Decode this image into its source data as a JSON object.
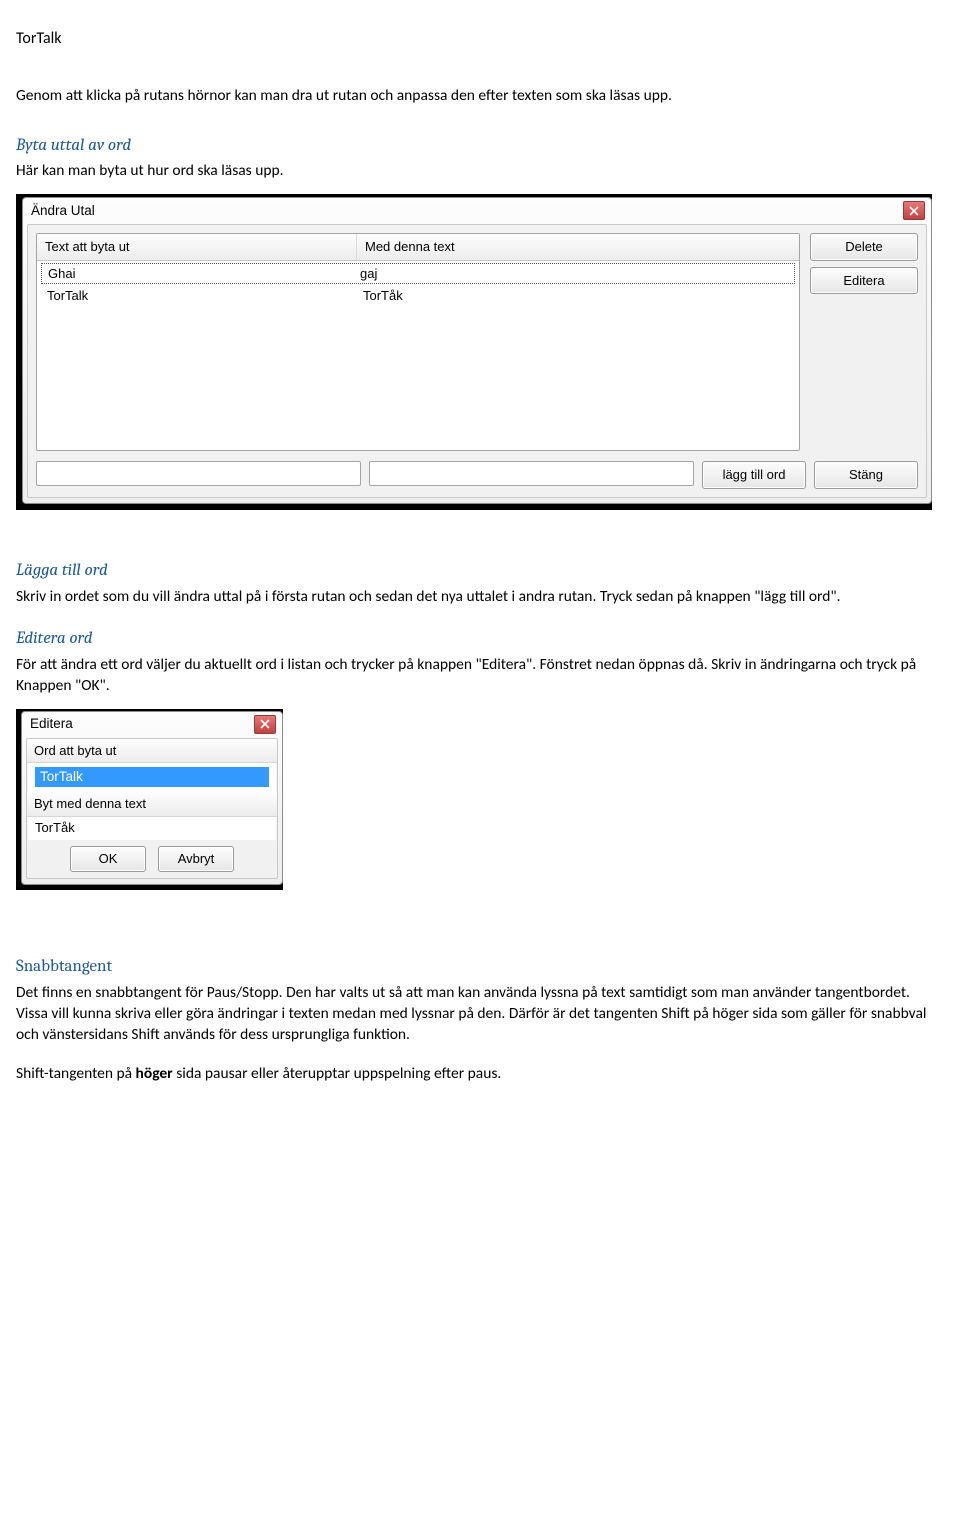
{
  "page": {
    "title": "TorTalk",
    "intro": "Genom att klicka på rutans hörnor kan man dra ut rutan och anpassa den efter texten som ska läsas upp."
  },
  "sec_byta": {
    "heading": "Byta uttal av ord",
    "text": "Här kan man byta ut hur ord ska läsas upp."
  },
  "andra_utal": {
    "title": "Ändra Utal",
    "col1": "Text att byta ut",
    "col2": "Med denna text",
    "rows": [
      {
        "a": "Ghai",
        "b": "gaj"
      },
      {
        "a": "TorTalk",
        "b": "TorTåk"
      }
    ],
    "btn_delete": "Delete",
    "btn_edit": "Editera",
    "btn_add": "lägg till ord",
    "btn_close": "Stäng"
  },
  "sec_lagga": {
    "heading": "Lägga till ord",
    "text": "Skriv in ordet som du vill ändra uttal på i första rutan och sedan det nya uttalet i andra rutan. Tryck sedan på knappen \"lägg till ord\"."
  },
  "sec_editera": {
    "heading": "Editera ord",
    "text": "För att ändra ett ord väljer du aktuellt ord i listan och trycker på knappen \"Editera\". Fönstret nedan öppnas då. Skriv in ändringarna och tryck på Knappen \"OK\"."
  },
  "editera_win": {
    "title": "Editera",
    "label1": "Ord att byta ut",
    "value1": "TorTalk",
    "label2": "Byt med denna text",
    "value2": "TorTåk",
    "btn_ok": "OK",
    "btn_cancel": "Avbryt"
  },
  "sec_snabb": {
    "heading": "Snabbtangent",
    "text1": "Det finns en snabbtangent för Paus/Stopp. Den har valts ut så att man kan använda lyssna på text samtidigt som man använder tangentbordet. Vissa vill kunna skriva eller göra ändringar i texten medan med lyssnar på den. Därför är det tangenten Shift på höger sida som gäller för snabbval och vänstersidans Shift används för dess ursprungliga funktion.",
    "text2_pre": "Shift-tangenten på ",
    "text2_bold": "höger",
    "text2_post": " sida pausar eller återupptar uppspelning efter paus."
  }
}
